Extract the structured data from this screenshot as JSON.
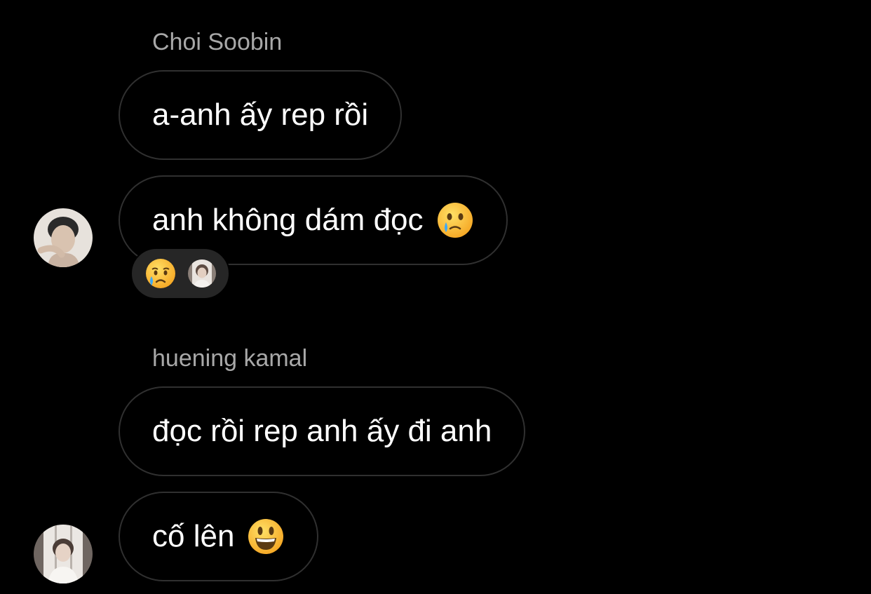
{
  "thread": {
    "groups": [
      {
        "sender": "Choi Soobin",
        "messages": [
          {
            "text": "a-anh ấy rep rồi",
            "emoji": ""
          },
          {
            "text": "anh không dám đọc",
            "emoji": "face-holding-back-tears"
          }
        ],
        "reaction": {
          "emoji": "crying-face"
        }
      },
      {
        "sender": "huening kamal",
        "messages": [
          {
            "text": "đọc rồi rep anh ấy đi anh",
            "emoji": ""
          },
          {
            "text": "cố lên",
            "emoji": "grinning-face-with-big-eyes"
          }
        ]
      }
    ]
  },
  "colors": {
    "background": "#000000",
    "bubble_border": "#303030",
    "sender_name": "#a8a8a8",
    "reaction_pill": "#262626",
    "emoji_yellow": "#ffcc33",
    "tear_blue": "#3fa9f5"
  }
}
